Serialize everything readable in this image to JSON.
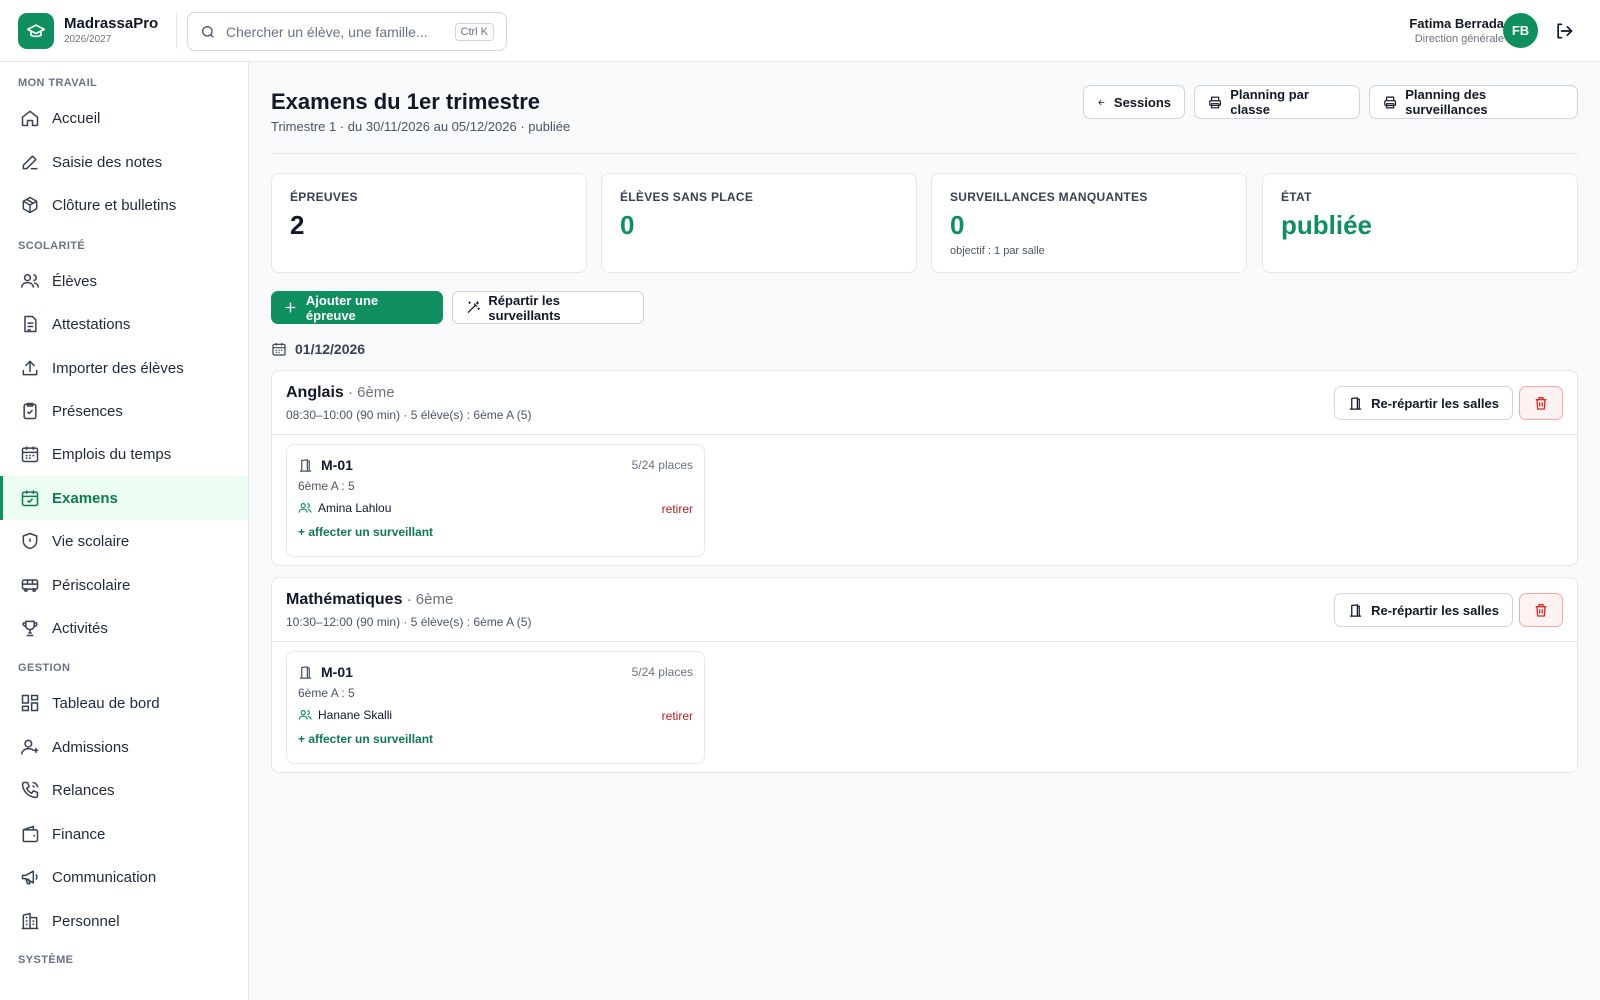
{
  "app": {
    "name": "MadrassaPro",
    "year": "2026/2027"
  },
  "search": {
    "placeholder": "Chercher un élève, une famille...",
    "shortcut": "Ctrl K"
  },
  "user": {
    "name": "Fatima Berrada",
    "role": "Direction générale",
    "initials": "FB"
  },
  "sidebar": {
    "sections": [
      "MON TRAVAIL",
      "SCOLARITÉ",
      "GESTION",
      "SYSTÈME"
    ],
    "items": [
      {
        "label": "Accueil",
        "icon": "home-icon"
      },
      {
        "label": "Saisie des notes",
        "icon": "pen-icon"
      },
      {
        "label": "Clôture et bulletins",
        "icon": "package-icon"
      },
      {
        "label": "Élèves",
        "icon": "users-icon"
      },
      {
        "label": "Attestations",
        "icon": "file-icon"
      },
      {
        "label": "Importer des élèves",
        "icon": "upload-icon"
      },
      {
        "label": "Présences",
        "icon": "clipboard-check-icon"
      },
      {
        "label": "Emplois du temps",
        "icon": "calendar-icon"
      },
      {
        "label": "Examens",
        "icon": "calendar-check-icon",
        "active": true
      },
      {
        "label": "Vie scolaire",
        "icon": "shield-icon"
      },
      {
        "label": "Périscolaire",
        "icon": "bus-icon"
      },
      {
        "label": "Activités",
        "icon": "trophy-icon"
      },
      {
        "label": "Tableau de bord",
        "icon": "dashboard-icon"
      },
      {
        "label": "Admissions",
        "icon": "user-plus-icon"
      },
      {
        "label": "Relances",
        "icon": "phone-icon"
      },
      {
        "label": "Finance",
        "icon": "wallet-icon"
      },
      {
        "label": "Communication",
        "icon": "megaphone-icon"
      },
      {
        "label": "Personnel",
        "icon": "building-icon"
      }
    ]
  },
  "page": {
    "title": "Examens du 1er trimestre",
    "subtitle": "Trimestre 1 · du 30/11/2026 au 05/12/2026 · publiée",
    "buttons": {
      "sessions": "Sessions",
      "planning_classe": "Planning par classe",
      "planning_surv": "Planning des surveillances"
    }
  },
  "stats": [
    {
      "label": "ÉPREUVES",
      "value": "2"
    },
    {
      "label": "ÉLÈVES SANS PLACE",
      "value": "0"
    },
    {
      "label": "SURVEILLANCES MANQUANTES",
      "value": "0",
      "note": "objectif : 1 par salle"
    },
    {
      "label": "ÉTAT",
      "value": "publiée"
    }
  ],
  "actions": {
    "add": "Ajouter une épreuve",
    "distribute": "Répartir les surveillants"
  },
  "date": "01/12/2026",
  "exams": [
    {
      "subject": "Anglais",
      "level": " · 6ème",
      "meta": "08:30–10:00 (90 min) · 5 élève(s) : 6ème A (5)",
      "redistribute": "Re-répartir les salles",
      "room": {
        "name": "M-01",
        "places": "5/24 places",
        "classes": "6ème A : 5",
        "supervisor": "Amina Lahlou",
        "remove": "retirer",
        "add": "+ affecter un surveillant"
      }
    },
    {
      "subject": "Mathématiques",
      "level": " · 6ème",
      "meta": "10:30–12:00 (90 min) · 5 élève(s) : 6ème A (5)",
      "redistribute": "Re-répartir les salles",
      "room": {
        "name": "M-01",
        "places": "5/24 places",
        "classes": "6ème A : 5",
        "supervisor": "Hanane Skalli",
        "remove": "retirer",
        "add": "+ affecter un surveillant"
      }
    }
  ],
  "colors": {
    "accent": "#0f8f5f",
    "danger": "#b91c1c",
    "active_bg": "#ecfdf3"
  }
}
